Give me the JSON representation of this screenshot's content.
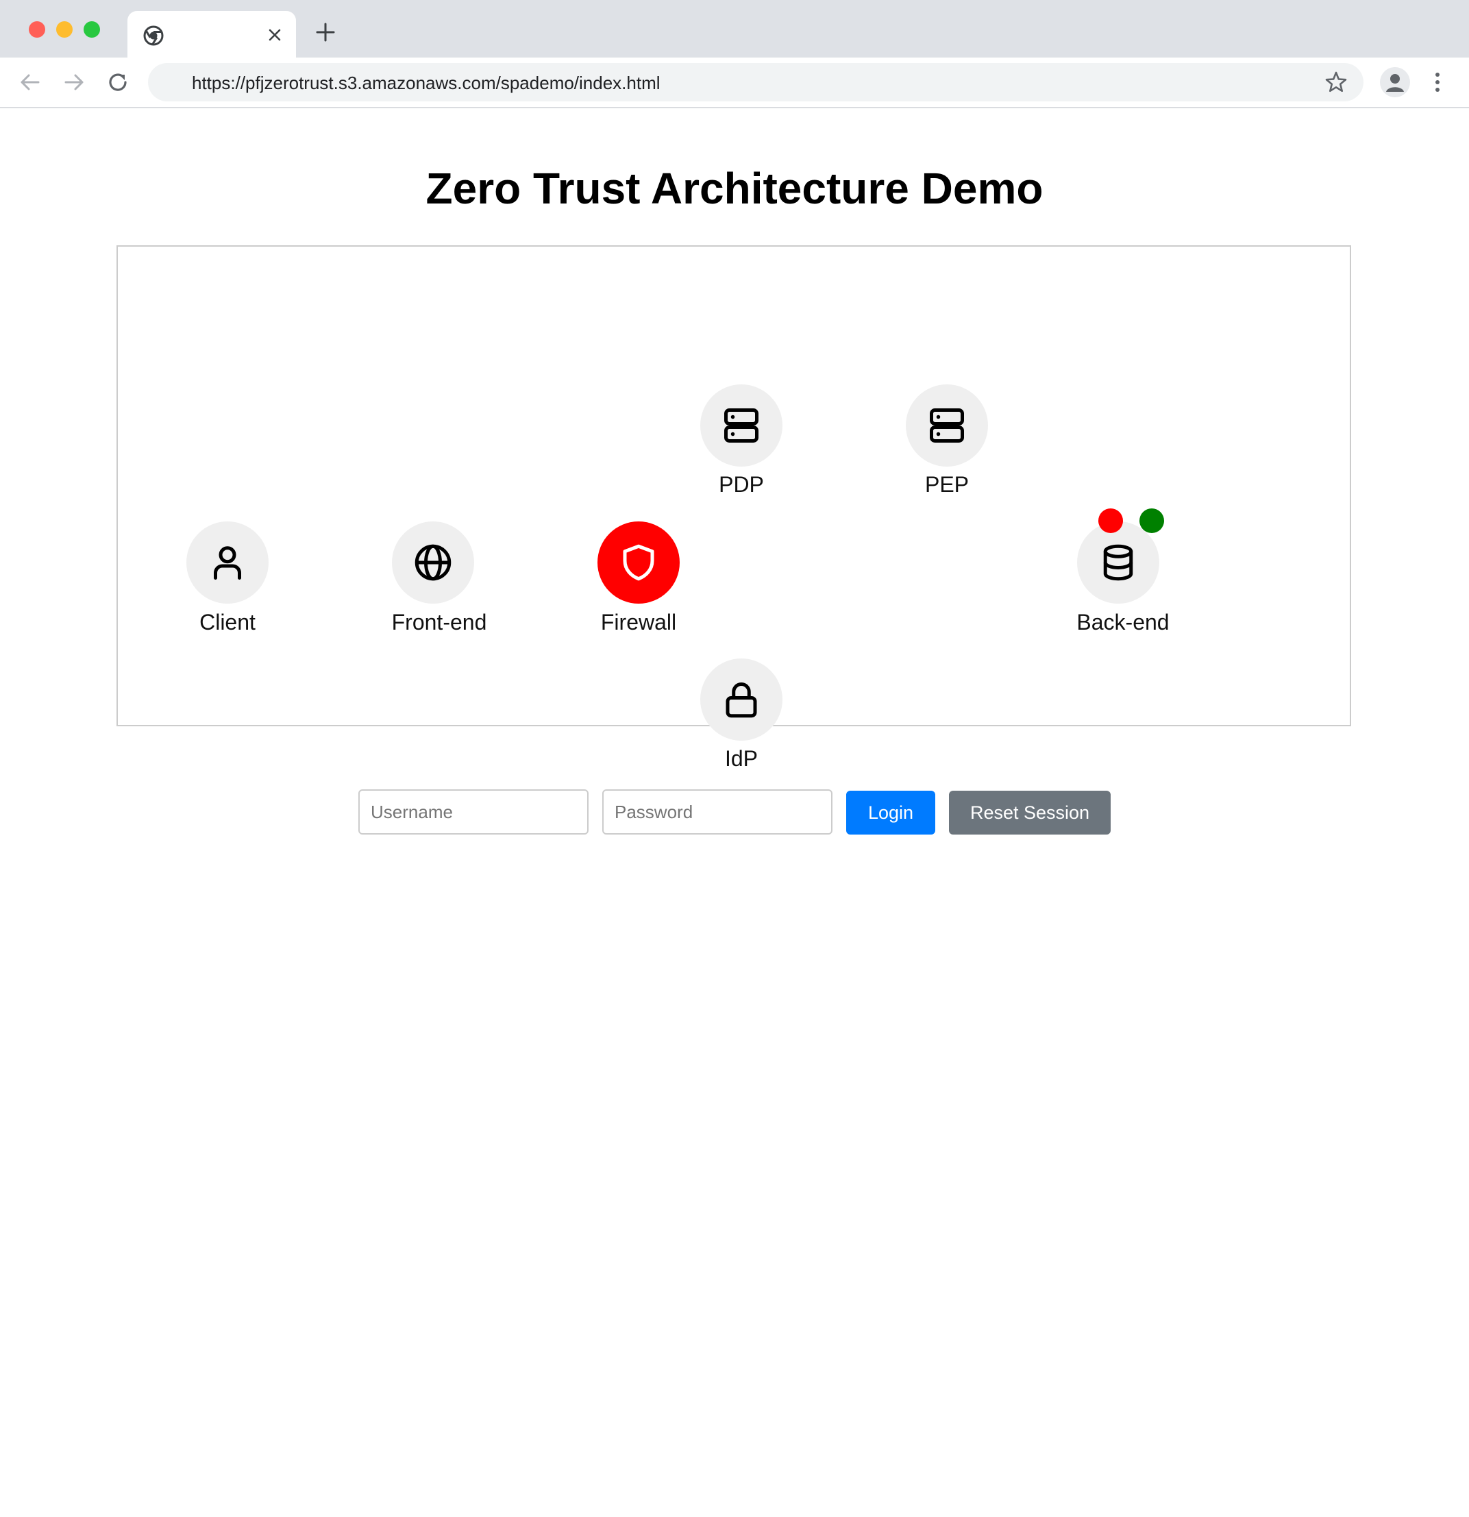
{
  "browser": {
    "url": "https://pfjzerotrust.s3.amazonaws.com/spademo/index.html",
    "tab_title": ""
  },
  "page": {
    "title": "Zero Trust Architecture Demo"
  },
  "diagram": {
    "nodes": {
      "client": {
        "label": "Client",
        "icon": "user-icon",
        "state": "default"
      },
      "frontend": {
        "label": "Front-end",
        "icon": "globe-icon",
        "state": "default"
      },
      "firewall": {
        "label": "Firewall",
        "icon": "shield-icon",
        "state": "alert"
      },
      "pdp": {
        "label": "PDP",
        "icon": "server-icon",
        "state": "default"
      },
      "pep": {
        "label": "PEP",
        "icon": "server-icon",
        "state": "default"
      },
      "backend": {
        "label": "Back-end",
        "icon": "database-icon",
        "state": "default"
      },
      "idp": {
        "label": "IdP",
        "icon": "lock-icon",
        "state": "default"
      }
    },
    "backend_indicators": [
      {
        "name": "red-indicator",
        "color": "#ff0000"
      },
      {
        "name": "green-indicator",
        "color": "#008000"
      }
    ],
    "colors": {
      "node_bg": "#efefef",
      "alert": "#ff0000"
    }
  },
  "form": {
    "username_placeholder": "Username",
    "username_value": "",
    "password_placeholder": "Password",
    "password_value": "",
    "login_label": "Login",
    "reset_label": "Reset Session",
    "colors": {
      "login": "#007bff",
      "reset": "#6c757d"
    }
  }
}
